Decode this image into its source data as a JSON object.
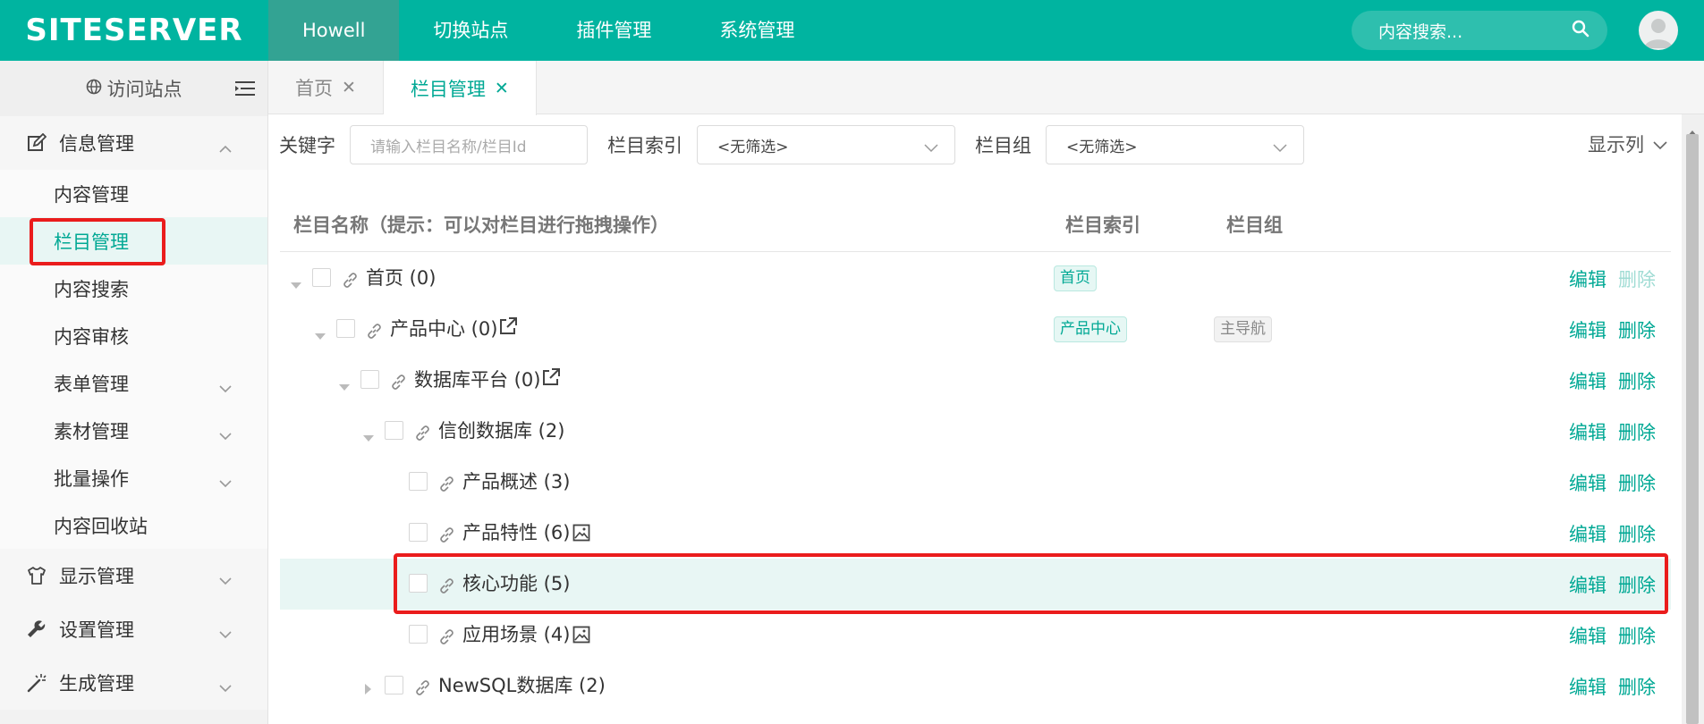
{
  "header": {
    "logo": "SITESERVER",
    "nav": [
      "Howell",
      "切换站点",
      "插件管理",
      "系统管理"
    ],
    "search_placeholder": "内容搜索...",
    "colors": {
      "brand": "#00b4a0",
      "accent": "#00a894",
      "highlight": "#ea1c1c"
    }
  },
  "sidebar": {
    "visit_label": "访问站点",
    "groups": [
      {
        "label": "信息管理",
        "icon": "edit-icon",
        "expanded": true,
        "items": [
          {
            "label": "内容管理"
          },
          {
            "label": "栏目管理",
            "active": true
          },
          {
            "label": "内容搜索"
          },
          {
            "label": "内容审核"
          },
          {
            "label": "表单管理",
            "expandable": true
          },
          {
            "label": "素材管理",
            "expandable": true
          },
          {
            "label": "批量操作",
            "expandable": true
          },
          {
            "label": "内容回收站"
          }
        ]
      },
      {
        "label": "显示管理",
        "icon": "tshirt-icon"
      },
      {
        "label": "设置管理",
        "icon": "wrench-icon"
      },
      {
        "label": "生成管理",
        "icon": "magic-wand-icon"
      }
    ]
  },
  "tabs": [
    {
      "label": "首页",
      "active": false
    },
    {
      "label": "栏目管理",
      "active": true
    }
  ],
  "filters": {
    "keyword_label": "关键字",
    "keyword_placeholder": "请输入栏目名称/栏目Id",
    "index_label": "栏目索引",
    "index_value": "<无筛选>",
    "group_label": "栏目组",
    "group_value": "<无筛选>",
    "columns_label": "显示列"
  },
  "table": {
    "headers": [
      "栏目名称（提示：可以对栏目进行拖拽操作）",
      "栏目索引",
      "栏目组"
    ],
    "edit_label": "编辑",
    "delete_label": "删除",
    "rows": [
      {
        "name": "首页 (0)",
        "index": "首页",
        "group": "",
        "expanded": true,
        "delete_disabled": true
      },
      {
        "name": "产品中心 (0)",
        "index": "产品中心",
        "group": "主导航",
        "expanded": true,
        "external": true
      },
      {
        "name": "数据库平台 (0)",
        "index": "",
        "group": "",
        "expanded": true,
        "external": true
      },
      {
        "name": "信创数据库 (2)",
        "index": "",
        "group": "",
        "expanded": true
      },
      {
        "name": "产品概述 (3)",
        "index": "",
        "group": ""
      },
      {
        "name": "产品特性 (6)",
        "index": "",
        "group": "",
        "image": true
      },
      {
        "name": "核心功能 (5)",
        "index": "",
        "group": "",
        "highlighted": true
      },
      {
        "name": "应用场景 (4)",
        "index": "",
        "group": "",
        "image": true
      },
      {
        "name": "NewSQL数据库 (2)",
        "index": "",
        "group": "",
        "collapsed": true
      }
    ]
  }
}
